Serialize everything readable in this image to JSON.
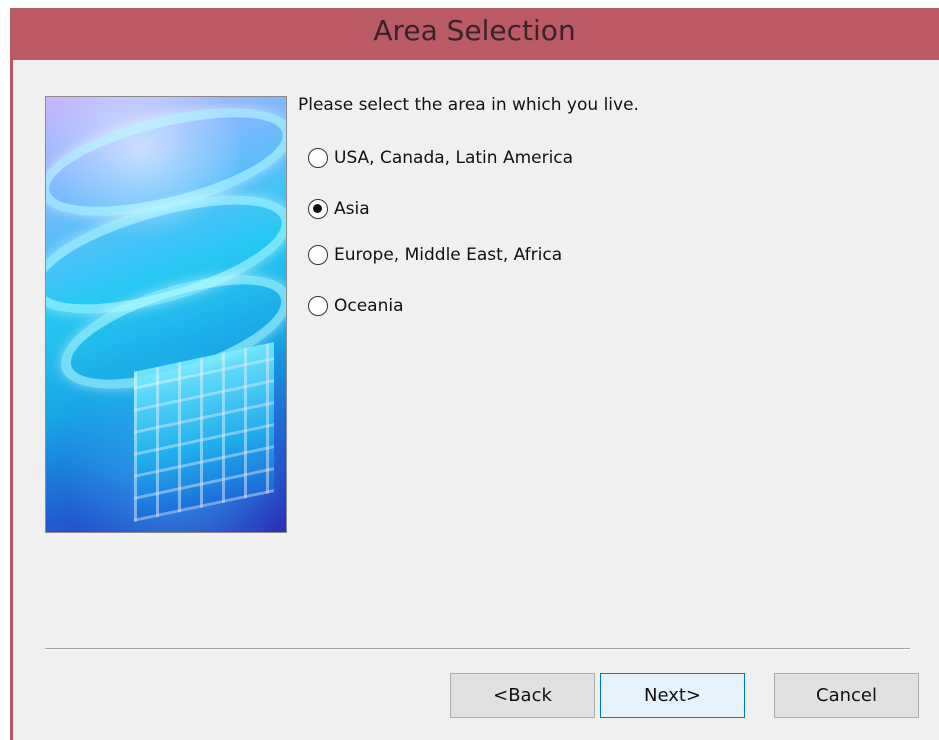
{
  "window": {
    "title": "Area Selection",
    "colors": {
      "titlebar": "#bb5a64",
      "client_bg": "#f0f0f0",
      "default_button_border": "#0078d7"
    }
  },
  "dialog": {
    "prompt": "Please select the area in which you live.",
    "options": [
      {
        "label": "USA, Canada, Latin America",
        "selected": false
      },
      {
        "label": "Asia",
        "selected": true
      },
      {
        "label": "Europe, Middle East, Africa",
        "selected": false
      },
      {
        "label": "Oceania",
        "selected": false
      }
    ],
    "banner_image": "blue-swirl-cubes-graphic"
  },
  "buttons": {
    "back": "<Back",
    "next": "Next>",
    "cancel": "Cancel"
  }
}
